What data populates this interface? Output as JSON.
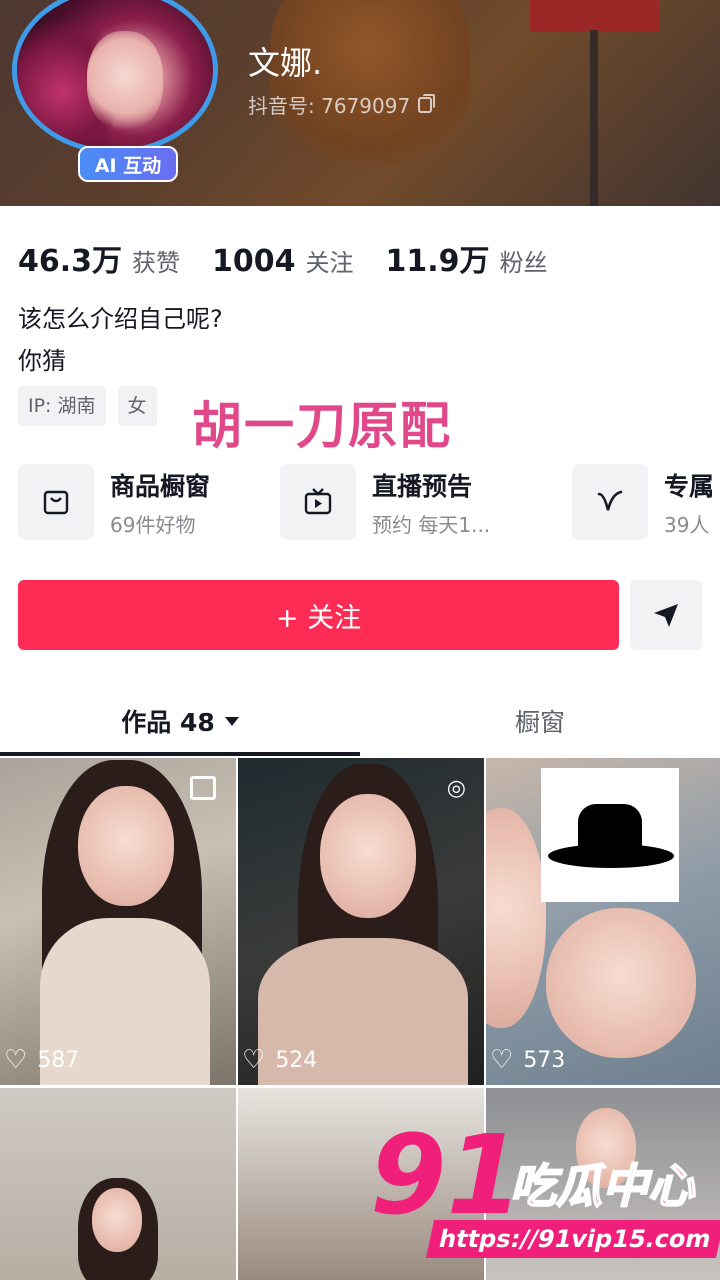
{
  "profile": {
    "nickname": "文娜.",
    "douyin_id": "抖音号: 7679097",
    "ai_badge": "AI 互动"
  },
  "stats": [
    {
      "value": "46.3万",
      "label": "获赞"
    },
    {
      "value": "1004",
      "label": "关注"
    },
    {
      "value": "11.9万",
      "label": "粉丝"
    }
  ],
  "bio": {
    "line1": "该怎么介绍自己呢?",
    "line2": "你猜"
  },
  "tags": {
    "ip": "IP: 湖南",
    "gender": "女"
  },
  "overlay_caption": "胡一刀原配",
  "services": [
    {
      "icon": "bag-icon",
      "title": "商品橱窗",
      "subtitle": "69件好物"
    },
    {
      "icon": "tv-icon",
      "title": "直播预告",
      "subtitle": "预约 每天1..."
    },
    {
      "icon": "v-badge-icon",
      "title": "专属",
      "subtitle": "39人"
    }
  ],
  "actions": {
    "follow": "+ 关注"
  },
  "tabs": {
    "works": "作品 48",
    "window": "橱窗"
  },
  "videos": [
    {
      "likes": "587"
    },
    {
      "likes": "524"
    },
    {
      "likes": "573"
    }
  ],
  "watermark": {
    "number": "91",
    "text": "吃瓜中心",
    "url": "https://91vip15.com"
  }
}
